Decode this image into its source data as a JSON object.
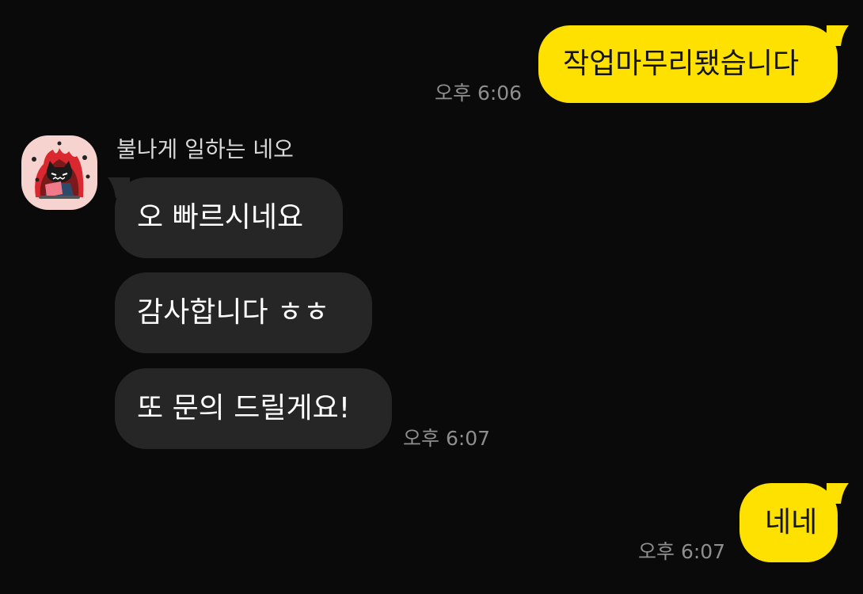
{
  "chat": {
    "sender_name": "불나게 일하는 네오",
    "messages": [
      {
        "from": "me",
        "text": "작업마무리됐습니다",
        "time": "오후 6:06"
      },
      {
        "from": "them",
        "text": "오 빠르시네요"
      },
      {
        "from": "them",
        "text": "감사합니다 ㅎㅎ"
      },
      {
        "from": "them",
        "text": "또 문의 드릴게요!",
        "time": "오후 6:07"
      },
      {
        "from": "me",
        "text": "네네",
        "time": "오후 6:07"
      }
    ]
  },
  "colors": {
    "background": "#0a0a0a",
    "my_bubble": "#ffe100",
    "their_bubble": "#262626",
    "timestamp": "#8e8e8e",
    "avatar_bg": "#f6d3cf"
  },
  "icons": {
    "avatar": "neo-character-avatar"
  }
}
